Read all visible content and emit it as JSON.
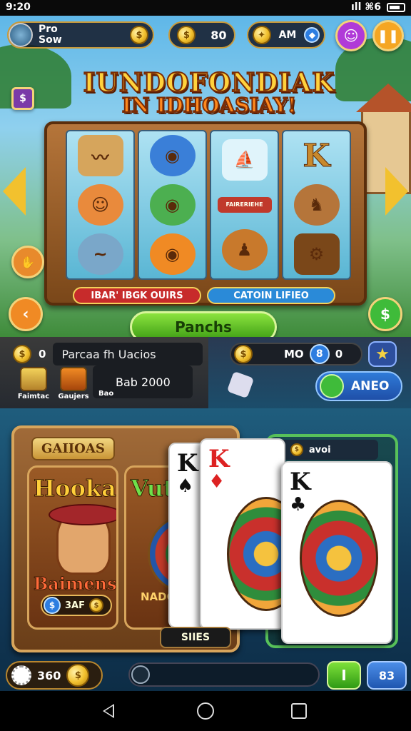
{
  "status_bar": {
    "time": "9:20",
    "left_icons": "ıll ⧉ ⊞ ıll",
    "right_icons": "ıll ⌘6"
  },
  "top_bar": {
    "profile_line1": "Pro",
    "profile_line2": "Sow",
    "coins_value": "80",
    "gem_label": "AM",
    "pause_icon": "pause-icon",
    "gift_icon": "gift-icon"
  },
  "title": {
    "line1": "IUNDOFONDIAK",
    "line2": "IN IDHOASIAY!"
  },
  "slot_machine": {
    "reels": [
      [
        "horn",
        "monkey",
        "dolphin"
      ],
      [
        "blue-fish",
        "green-fish",
        "orange-fish"
      ],
      [
        "boat",
        "tag",
        "bird"
      ],
      [
        "K",
        "monkey-hat",
        "crate"
      ]
    ],
    "tag_text": "FAIRERIEHE",
    "banner_left": "IBAR' IBGK OUIRS",
    "banner_right": "CATOIN LIFIEO",
    "play_label": "Panchs"
  },
  "mid_bar": {
    "row1_prefix": "0",
    "row1_text": "Parcaa fh Uacios",
    "items": [
      {
        "label": "Faimtac"
      },
      {
        "label": "Gaujers"
      },
      {
        "label": "Bao"
      }
    ],
    "input2_text": "Bab 2000",
    "wallet_value": "MO",
    "wallet_badges": [
      "8",
      "0"
    ],
    "aneo_label": "ANEO"
  },
  "bottom": {
    "board_title": "GAIIOAS",
    "tile1": {
      "title1": "Hooka",
      "title2": "Baimens",
      "price": "3AF"
    },
    "tile2": {
      "title": "Vuta",
      "label": "NADO"
    },
    "cards": [
      {
        "rank": "K",
        "suit": "♠"
      },
      {
        "rank": "K",
        "suit": "♦"
      },
      {
        "rank": "K",
        "suit": "♣"
      }
    ],
    "green_panel_label": "avoi",
    "spin_label": "SIIES",
    "balance": "360",
    "progress_value": 0.0,
    "green_button": "I",
    "blue_button": "83"
  },
  "colors": {
    "accent_gold": "#f2c12e",
    "play_green": "#3c9c14",
    "ui_blue": "#1f56b0"
  }
}
